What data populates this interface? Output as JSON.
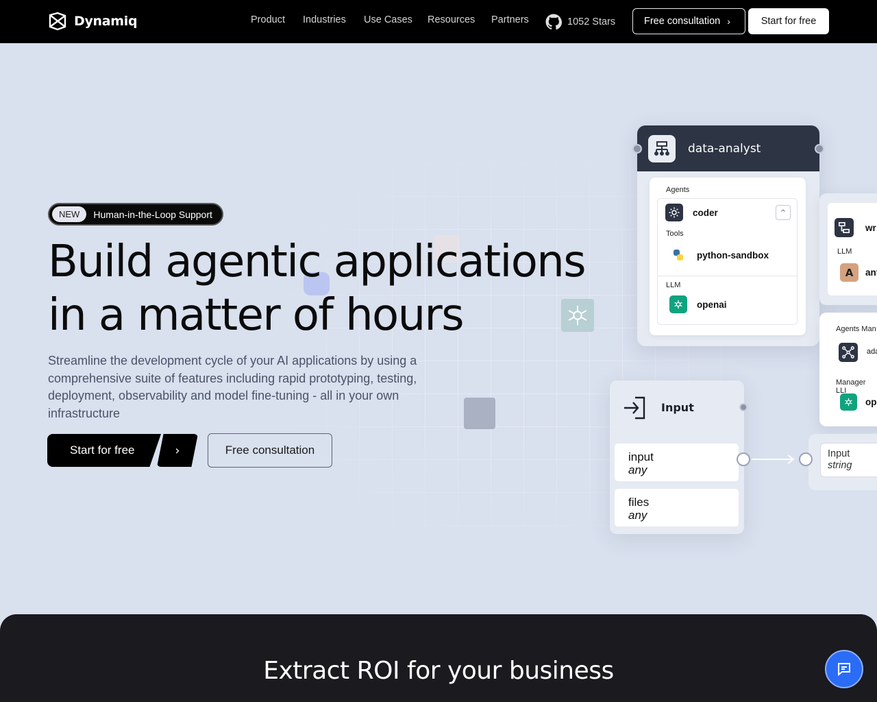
{
  "brand": {
    "name": "Dynamiq"
  },
  "nav": {
    "links": [
      "Product",
      "Industries",
      "Use Cases",
      "Resources",
      "Partners"
    ],
    "github_stars": "1052 Stars",
    "consult_label": "Free consultation",
    "start_label": "Start for free"
  },
  "hero": {
    "badge_new": "NEW",
    "badge_text": "Human-in-the-Loop Support",
    "title_line1": "Build agentic applications",
    "title_line2": "in a matter of hours",
    "subtitle": "Streamline the development cycle of your AI applications by using a comprehensive suite of features including rapid prototyping, testing, deployment, observability and model fine-tuning - all in your own infrastructure",
    "cta_primary": "Start for free",
    "cta_secondary": "Free consultation"
  },
  "workflow": {
    "main_node": {
      "title": "data-analyst",
      "agents_label": "Agents",
      "agent": "coder",
      "tools_label": "Tools",
      "tool": "python-sandbox",
      "llm_label": "LLM",
      "llm": "openai"
    },
    "right_node1": {
      "llm_label": "LLM",
      "title_partial": "wr",
      "llm_partial": "ant"
    },
    "right_node2": {
      "agents_label": "Agents Man",
      "agent_partial": "ada",
      "manager_label": "Manager LLI",
      "llm_partial": "ope"
    },
    "input_node": {
      "title": "Input",
      "ports": [
        {
          "name": "input",
          "type": "any"
        },
        {
          "name": "files",
          "type": "any"
        }
      ]
    },
    "target_port": {
      "name": "Input",
      "type": "string"
    }
  },
  "section2": {
    "title": "Extract ROI for your business"
  },
  "colors": {
    "accent": "#2b6cf6",
    "dark": "#000000",
    "hero_bg": "#d9e0ee",
    "node_header": "#2d3444"
  }
}
